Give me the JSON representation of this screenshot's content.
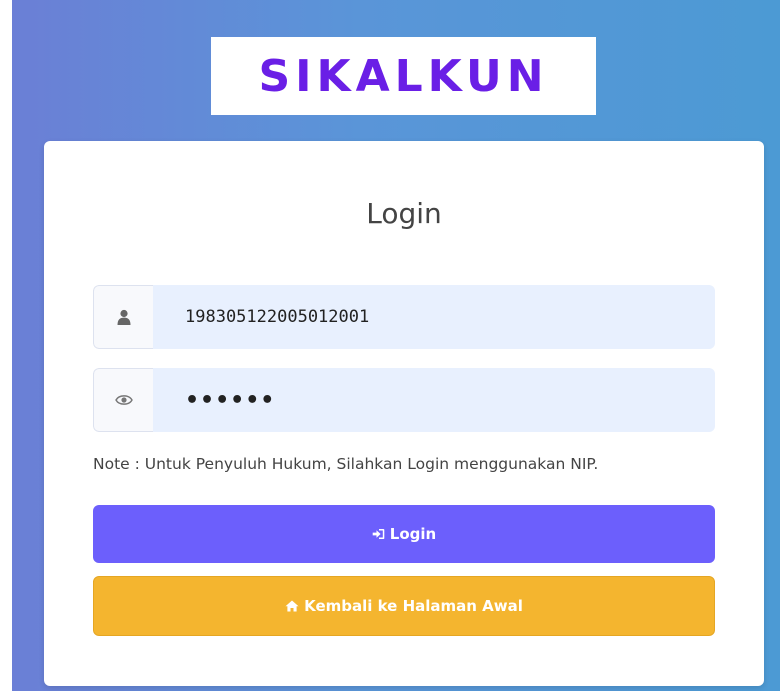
{
  "app": {
    "logo_text": "SIKALKUN"
  },
  "login_card": {
    "title": "Login",
    "username_value": "198305122005012001",
    "password_value": "••••••",
    "note": "Note : Untuk Penyuluh Hukum, Silahkan Login menggunakan NIP.",
    "login_button_label": "Login",
    "home_button_label": "Kembali ke Halaman Awal"
  },
  "icons": {
    "username": "user-icon",
    "password": "eye-icon",
    "login_button": "sign-in-icon",
    "home_button": "home-icon"
  },
  "colors": {
    "brand": "#6a1fe6",
    "login_button": "#6c5ffc",
    "home_button": "#f4b52f",
    "input_background": "#e8f0fe"
  }
}
